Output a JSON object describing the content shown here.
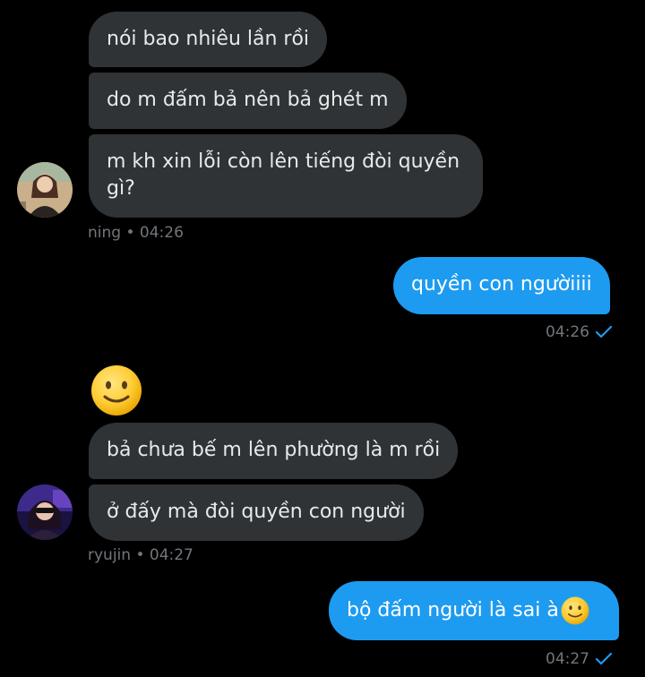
{
  "colors": {
    "background": "#000000",
    "incoming_bubble": "#2f3336",
    "outgoing_bubble": "#1d9bf0",
    "meta_text": "#71767b",
    "check": "#1d9bf0"
  },
  "messages": {
    "ning_1": "nói bao nhiêu lần rồi",
    "ning_2": "do m đấm bả nên bả ghét m",
    "ning_3": "m kh xin lỗi còn lên tiếng đòi quyền gì?",
    "ning_meta": "ning • 04:26",
    "me_1": "quyền con ngườiiii",
    "me_1_time": "04:26",
    "ryujin_1": "bả chưa bế m lên phường là m rồi",
    "ryujin_2": "ở đấy mà đòi quyền con người",
    "ryujin_meta": "ryujin • 04:27",
    "me_2": "bộ đấm người là sai à",
    "me_2_time": "04:27"
  },
  "icons": {
    "standalone_emoji": "slightly-smiling-face-icon",
    "inline_emoji": "slightly-smiling-face-icon",
    "read_receipt": "check-icon"
  }
}
